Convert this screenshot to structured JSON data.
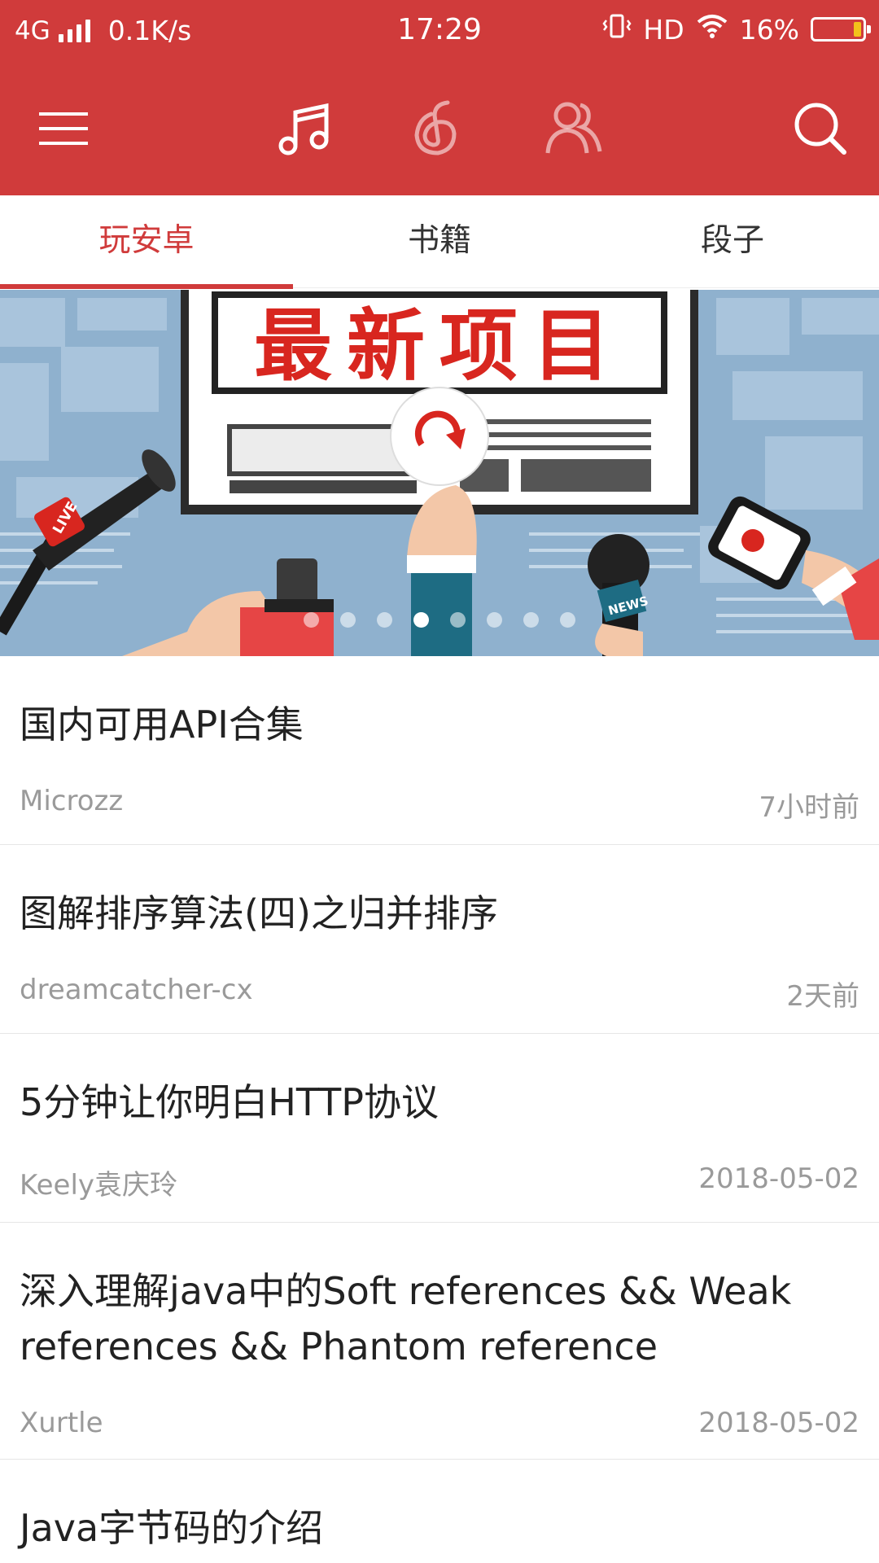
{
  "status_bar": {
    "network": "4G",
    "speed": "0.1K/s",
    "time": "17:29",
    "hd": "HD",
    "battery": "16%",
    "battery_level": 0.16
  },
  "toolbar": {
    "icons": [
      "menu-icon",
      "music-note-icon",
      "netease-logo-icon",
      "friends-icon",
      "search-icon"
    ]
  },
  "tabs": [
    {
      "label": "玩安卓",
      "active": true
    },
    {
      "label": "书籍",
      "active": false
    },
    {
      "label": "段子",
      "active": false
    }
  ],
  "banner": {
    "title": "最新项目",
    "badge_live": "LIVE",
    "badge_news": "NEWS",
    "slide_count": 8,
    "active_slide": 3
  },
  "articles": [
    {
      "title": "国内可用API合集",
      "author": "Microzz",
      "time": "7小时前"
    },
    {
      "title": "图解排序算法(四)之归并排序",
      "author": "dreamcatcher-cx",
      "time": "2天前"
    },
    {
      "title": "5分钟让你明白HTTP协议",
      "author": "Keely袁庆玲",
      "time": "2018-05-02"
    },
    {
      "title": "深入理解java中的Soft references && Weak references && Phantom reference",
      "author": "Xurtle",
      "time": "2018-05-02"
    },
    {
      "title": "Java字节码的介绍",
      "author": "",
      "time": ""
    }
  ],
  "colors": {
    "primary": "#d03b3b",
    "text_dark": "#222222",
    "text_muted": "#9a9a9a"
  }
}
